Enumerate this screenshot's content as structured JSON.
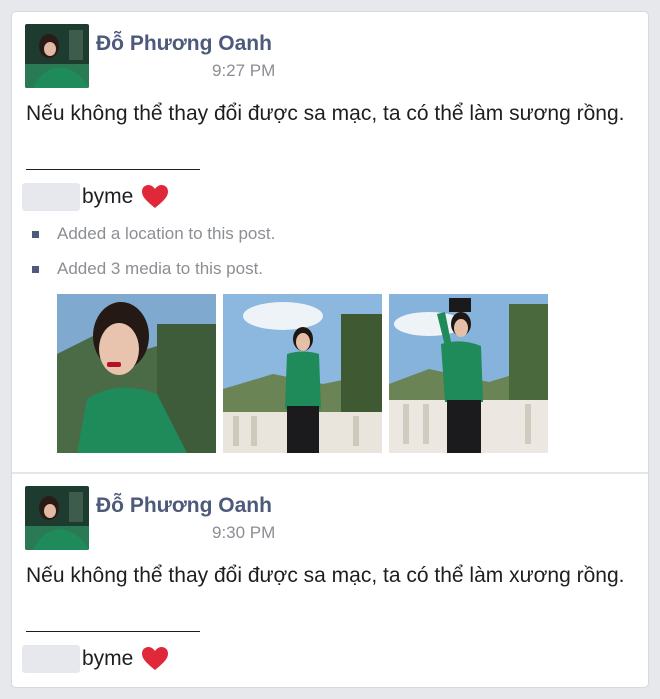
{
  "posts": [
    {
      "author": "Đỗ Phương Oanh",
      "time": "9:27 PM",
      "message": "Nếu không thể thay đổi được sa mạc, ta có thể làm sương rồng.",
      "signature": "byme",
      "activity": [
        "Added a location to this post.",
        "Added 3 media to this post."
      ]
    },
    {
      "author": "Đỗ Phương Oanh",
      "time": "9:30 PM",
      "message": "Nếu không thể thay đổi được sa mạc, ta có thể làm xương rồng.",
      "signature": "byme"
    }
  ],
  "colors": {
    "author": "#4d5a7a",
    "meta_text": "#8b8e93",
    "heart": "#e0283a",
    "outfit_green": "#1f8a5a"
  },
  "icons": [
    "heart-emoji-icon",
    "bullet-icon"
  ]
}
